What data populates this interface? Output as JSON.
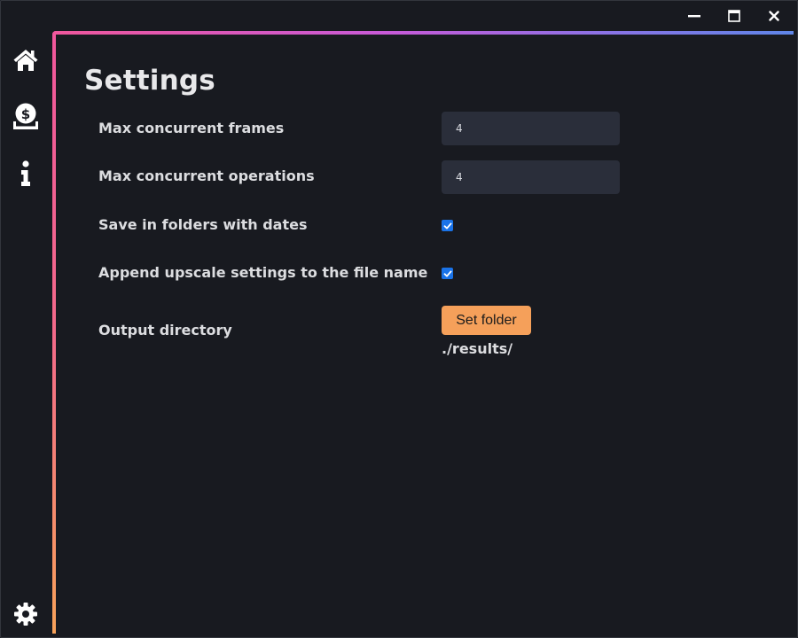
{
  "window": {
    "controls": [
      "minimize-icon",
      "maximize-icon",
      "close-icon"
    ]
  },
  "sidebar": {
    "items": [
      {
        "icon": "home-icon"
      },
      {
        "icon": "money-bag-icon"
      },
      {
        "icon": "info-icon"
      }
    ],
    "footer_icon": "gear-icon"
  },
  "colors": {
    "background": "#181a20",
    "input_bg": "#2a2e3a",
    "accent_orange": "#f5a05a",
    "gradient_pink": "#f0579c",
    "gradient_blue": "#5f86e8",
    "checkbox_blue": "#1a73e8"
  },
  "settings": {
    "title": "Settings",
    "max_frames": {
      "label": "Max concurrent frames",
      "value": "4"
    },
    "max_operations": {
      "label": "Max concurrent operations",
      "value": "4"
    },
    "save_dates": {
      "label": "Save in folders with dates",
      "checked": true
    },
    "append_settings": {
      "label": "Append upscale settings to the file name",
      "checked": true
    },
    "output_directory": {
      "label": "Output directory",
      "button_label": "Set folder",
      "path": "./results/"
    }
  }
}
